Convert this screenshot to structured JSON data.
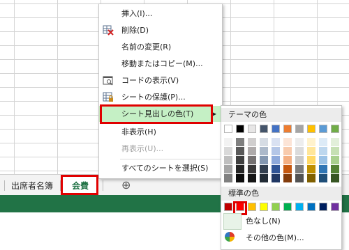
{
  "context_menu": {
    "items": [
      {
        "label": "挿入(I)...",
        "icon": "insert-icon",
        "enabled": true
      },
      {
        "label": "削除(D)",
        "icon": "delete-sheet-icon",
        "enabled": true
      },
      {
        "label": "名前の変更(R)",
        "icon": "",
        "enabled": true
      },
      {
        "label": "移動またはコピー(M)...",
        "icon": "",
        "enabled": true
      },
      {
        "label": "コードの表示(V)",
        "icon": "view-code-icon",
        "enabled": true
      },
      {
        "label": "シートの保護(P)...",
        "icon": "protect-sheet-icon",
        "enabled": true
      },
      {
        "label": "シート見出しの色(T)",
        "icon": "",
        "enabled": true,
        "highlighted": true
      },
      {
        "label": "非表示(H)",
        "icon": "",
        "enabled": true
      },
      {
        "label": "再表示(U)...",
        "icon": "",
        "enabled": false
      },
      {
        "label": "すべてのシートを選択(S)",
        "icon": "",
        "enabled": true
      }
    ]
  },
  "color_submenu": {
    "theme_header": "テーマの色",
    "standard_header": "標準の色",
    "no_color_label": "色なし(N)",
    "more_colors_label": "その他の色(M)...",
    "theme_colors": [
      "#FFFFFF",
      "#000000",
      "#E7E6E6",
      "#44546A",
      "#4472C4",
      "#ED7D31",
      "#A5A5A5",
      "#FFC000",
      "#5B9BD5",
      "#70AD47"
    ],
    "theme_shades": [
      [
        "#F2F2F2",
        "#7F7F7F",
        "#D0CECE",
        "#D6DCE4",
        "#D9E1F2",
        "#FCE4D6",
        "#EDEDED",
        "#FFF2CC",
        "#DDEBF7",
        "#E2EFDA"
      ],
      [
        "#D9D9D9",
        "#595959",
        "#AEAAAA",
        "#ACB9CA",
        "#B4C6E7",
        "#F8CBAD",
        "#DBDBDB",
        "#FFE699",
        "#BDD7EE",
        "#C6E0B4"
      ],
      [
        "#BFBFBF",
        "#404040",
        "#757171",
        "#8497B0",
        "#8EA9DB",
        "#F4B084",
        "#C9C9C9",
        "#FFD966",
        "#9BC2E6",
        "#A9D08E"
      ],
      [
        "#A6A6A6",
        "#262626",
        "#3A3838",
        "#333F4F",
        "#305496",
        "#C65911",
        "#7B7B7B",
        "#BF8F00",
        "#2F75B5",
        "#548235"
      ],
      [
        "#808080",
        "#0D0D0D",
        "#161616",
        "#222B35",
        "#203764",
        "#833C0C",
        "#525252",
        "#806000",
        "#1F4E78",
        "#375623"
      ]
    ],
    "standard_colors": [
      "#C00000",
      "#FF0000",
      "#FFC000",
      "#FFFF00",
      "#92D050",
      "#00B050",
      "#00B0F0",
      "#0070C0",
      "#002060",
      "#7030A0"
    ],
    "selected_standard_index": 1
  },
  "sheet_tabs": [
    {
      "label": "出席者名簿",
      "active": false
    },
    {
      "label": "会費",
      "active": true
    }
  ],
  "add_sheet_symbol": "⊕",
  "accent_green": "#217346",
  "highlight_red": "#E00000"
}
